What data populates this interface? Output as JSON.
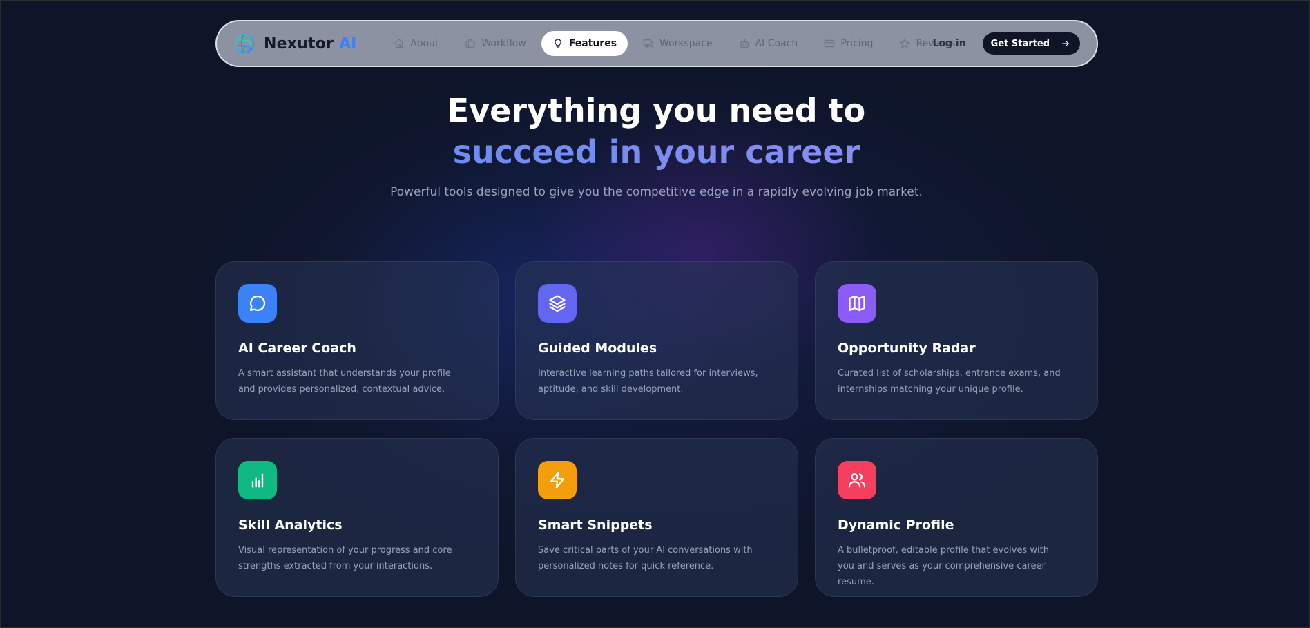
{
  "brand": {
    "name_main": "Nexutor ",
    "name_accent": "AI",
    "logo_icon": "globe-brain-logo-icon"
  },
  "nav": {
    "items": [
      {
        "label": "About",
        "icon": "home-icon",
        "active": false
      },
      {
        "label": "Workflow",
        "icon": "briefcase-icon",
        "active": false
      },
      {
        "label": "Features",
        "icon": "lightbulb-icon",
        "active": true
      },
      {
        "label": "Workspace",
        "icon": "monitor-icon",
        "active": false
      },
      {
        "label": "AI Coach",
        "icon": "robot-icon",
        "active": false
      },
      {
        "label": "Pricing",
        "icon": "credit-card-icon",
        "active": false
      },
      {
        "label": "Reviews",
        "icon": "star-icon",
        "active": false
      }
    ],
    "login_label": "Log in",
    "cta_label": "Get Started"
  },
  "hero": {
    "title_line1": "Everything you need to",
    "title_line2": "succeed in your career",
    "subtitle": "Powerful tools designed to give you the competitive edge in a rapidly evolving job market."
  },
  "features": [
    {
      "title": "AI Career Coach",
      "description": "A smart assistant that understands your profile and provides personalized, contextual advice.",
      "icon": "chat-bubble-icon",
      "color": "#3b82f6"
    },
    {
      "title": "Guided Modules",
      "description": "Interactive learning paths tailored for interviews, aptitude, and skill development.",
      "icon": "layers-icon",
      "color": "#6366f1"
    },
    {
      "title": "Opportunity Radar",
      "description": "Curated list of scholarships, entrance exams, and internships matching your unique profile.",
      "icon": "map-icon",
      "color": "#8b5cf6"
    },
    {
      "title": "Skill Analytics",
      "description": "Visual representation of your progress and core strengths extracted from your interactions.",
      "icon": "bar-chart-icon",
      "color": "#10b981"
    },
    {
      "title": "Smart Snippets",
      "description": "Save critical parts of your AI conversations with personalized notes for quick reference.",
      "icon": "lightning-icon",
      "color": "#f59e0b"
    },
    {
      "title": "Dynamic Profile",
      "description": "A bulletproof, editable profile that evolves with you and serves as your comprehensive career resume.",
      "icon": "users-icon",
      "color": "#f43f5e"
    }
  ]
}
